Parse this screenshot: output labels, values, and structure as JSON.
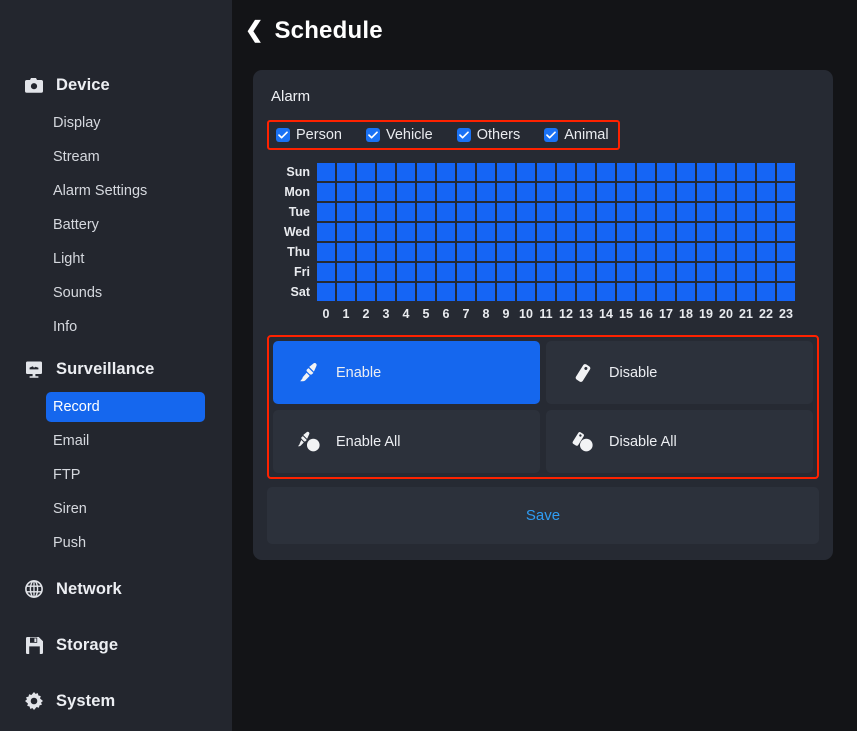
{
  "header": {
    "title": "Schedule",
    "back_icon": "chevron-left-icon"
  },
  "sidebar": {
    "groups": [
      {
        "label": "Device",
        "icon": "camera-icon",
        "items": [
          {
            "label": "Display",
            "active": false
          },
          {
            "label": "Stream",
            "active": false
          },
          {
            "label": "Alarm Settings",
            "active": false
          },
          {
            "label": "Battery",
            "active": false
          },
          {
            "label": "Light",
            "active": false
          },
          {
            "label": "Sounds",
            "active": false
          },
          {
            "label": "Info",
            "active": false
          }
        ]
      },
      {
        "label": "Surveillance",
        "icon": "monitor-icon",
        "items": [
          {
            "label": "Record",
            "active": true
          },
          {
            "label": "Email",
            "active": false
          },
          {
            "label": "FTP",
            "active": false
          },
          {
            "label": "Siren",
            "active": false
          },
          {
            "label": "Push",
            "active": false
          }
        ]
      },
      {
        "label": "Network",
        "icon": "globe-icon",
        "items": []
      },
      {
        "label": "Storage",
        "icon": "floppy-disk-icon",
        "items": []
      },
      {
        "label": "System",
        "icon": "gear-icon",
        "items": []
      }
    ]
  },
  "panel": {
    "title": "Alarm",
    "detection_types": [
      {
        "label": "Person",
        "checked": true
      },
      {
        "label": "Vehicle",
        "checked": true
      },
      {
        "label": "Others",
        "checked": true
      },
      {
        "label": "Animal",
        "checked": true
      }
    ],
    "schedule": {
      "days": [
        "Sun",
        "Mon",
        "Tue",
        "Wed",
        "Thu",
        "Fri",
        "Sat"
      ],
      "hours": [
        "0",
        "1",
        "2",
        "3",
        "4",
        "5",
        "6",
        "7",
        "8",
        "9",
        "10",
        "11",
        "12",
        "13",
        "14",
        "15",
        "16",
        "17",
        "18",
        "19",
        "20",
        "21",
        "22",
        "23"
      ],
      "cells": [
        [
          1,
          1,
          1,
          1,
          1,
          1,
          1,
          1,
          1,
          1,
          1,
          1,
          1,
          1,
          1,
          1,
          1,
          1,
          1,
          1,
          1,
          1,
          1,
          1
        ],
        [
          1,
          1,
          1,
          1,
          1,
          1,
          1,
          1,
          1,
          1,
          1,
          1,
          1,
          1,
          1,
          1,
          1,
          1,
          1,
          1,
          1,
          1,
          1,
          1
        ],
        [
          1,
          1,
          1,
          1,
          1,
          1,
          1,
          1,
          1,
          1,
          1,
          1,
          1,
          1,
          1,
          1,
          1,
          1,
          1,
          1,
          1,
          1,
          1,
          1
        ],
        [
          1,
          1,
          1,
          1,
          1,
          1,
          1,
          1,
          1,
          1,
          1,
          1,
          1,
          1,
          1,
          1,
          1,
          1,
          1,
          1,
          1,
          1,
          1,
          1
        ],
        [
          1,
          1,
          1,
          1,
          1,
          1,
          1,
          1,
          1,
          1,
          1,
          1,
          1,
          1,
          1,
          1,
          1,
          1,
          1,
          1,
          1,
          1,
          1,
          1
        ],
        [
          1,
          1,
          1,
          1,
          1,
          1,
          1,
          1,
          1,
          1,
          1,
          1,
          1,
          1,
          1,
          1,
          1,
          1,
          1,
          1,
          1,
          1,
          1,
          1
        ],
        [
          1,
          1,
          1,
          1,
          1,
          1,
          1,
          1,
          1,
          1,
          1,
          1,
          1,
          1,
          1,
          1,
          1,
          1,
          1,
          1,
          1,
          1,
          1,
          1
        ]
      ],
      "cell_on_color": "#1565f5"
    },
    "actions": [
      {
        "label": "Enable",
        "icon": "brush-icon",
        "active": true
      },
      {
        "label": "Disable",
        "icon": "eraser-icon",
        "active": false
      },
      {
        "label": "Enable All",
        "icon": "brush-fill-icon",
        "active": false
      },
      {
        "label": "Disable All",
        "icon": "eraser-fill-icon",
        "active": false
      }
    ],
    "save_label": "Save"
  },
  "colors": {
    "accent_blue": "#1567ee",
    "highlight_red": "#fe2200",
    "save_text": "#2f9cf3"
  }
}
